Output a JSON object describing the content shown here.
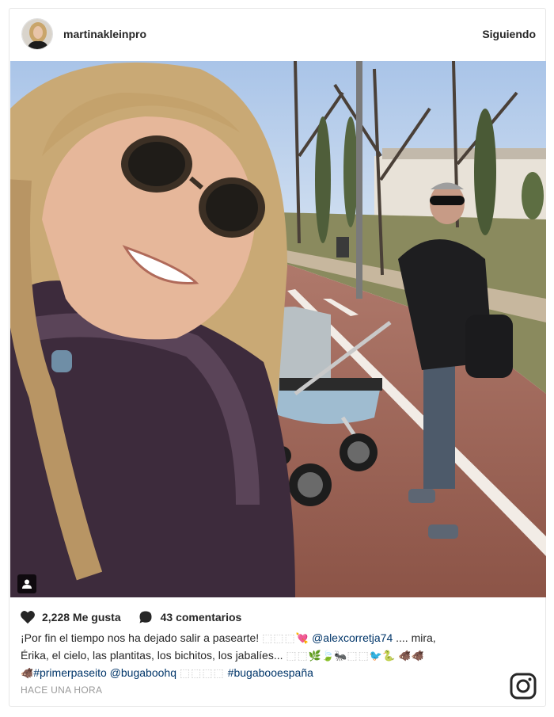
{
  "header": {
    "username": "martinakleinpro",
    "follow_label": "Siguiendo"
  },
  "post": {
    "likes": "2,228 Me gusta",
    "comments": "43 comentarios",
    "caption": {
      "line1_text": "¡Por fin el tiempo nos ha dejado salir a pasearte! ",
      "line1_boxes": "⬚⬚⬚",
      "line1_emoji": "💘 ",
      "line1_mention": "@alexcorretja74",
      "line1_rest": " .... mira,",
      "line2_text": "Érika, el cielo, las plantitas, los bichitos, los jabalíes... ",
      "line2_boxes": "⬚⬚",
      "line2_emoji": "🌿🍃🐜",
      "line2_boxes2": "⬚⬚",
      "line2_emoji2": "🐦🐍 🐗🐗",
      "line3_emoji": "🐗",
      "line3_tag1": "#primerpaseito",
      "line3_mention": " @bugaboohq ",
      "line3_boxes": "⬚⬚⬚⬚",
      "line3_tag2": " #bugabooespaña"
    },
    "time": "HACE UNA HORA"
  },
  "icons": {
    "avatar": "profile-photo",
    "tag_badge": "person-tag-icon",
    "like": "heart-icon",
    "comment": "comment-bubble-icon",
    "brand": "instagram-logo-icon"
  }
}
